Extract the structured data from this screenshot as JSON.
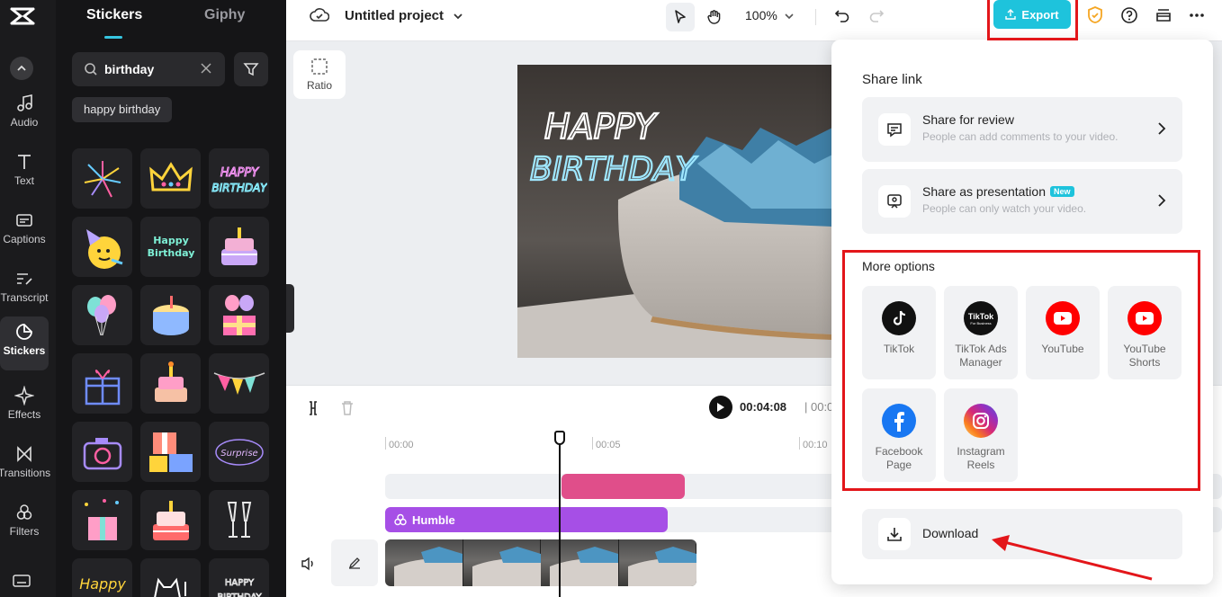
{
  "rail": {
    "items": [
      {
        "label": "Audio",
        "icon": "music-note-icon"
      },
      {
        "label": "Text",
        "icon": "text-icon"
      },
      {
        "label": "Captions",
        "icon": "captions-icon"
      },
      {
        "label": "Transcript",
        "icon": "transcript-icon"
      },
      {
        "label": "Stickers",
        "icon": "sticker-icon",
        "active": true
      },
      {
        "label": "Effects",
        "icon": "sparkle-icon"
      },
      {
        "label": "Transitions",
        "icon": "transition-icon"
      },
      {
        "label": "Filters",
        "icon": "filter-circles-icon"
      }
    ]
  },
  "panel": {
    "tabs": [
      "Stickers",
      "Giphy"
    ],
    "search": {
      "value": "birthday"
    },
    "chip": "happy birthday",
    "stickers": [
      "HAPPY BIRTHDAY",
      "Happy Birthday",
      "Surprise",
      "Happy Birthday"
    ]
  },
  "topbar": {
    "project_name": "Untitled project",
    "zoom": "100%",
    "export_label": "Export"
  },
  "canvas": {
    "ratio_label": "Ratio",
    "overlay_line1": "HAPPY",
    "overlay_line2": "BIRTHDAY"
  },
  "timeline": {
    "current_time": "00:04:08",
    "total_time_partial": "| 00:0",
    "ruler": [
      "00:00",
      "00:05",
      "00:10"
    ],
    "audio_clip_label": "Humble"
  },
  "export_menu": {
    "share_link_title": "Share link",
    "share_review": {
      "title": "Share for review",
      "desc": "People can add comments to your video."
    },
    "share_presentation": {
      "title": "Share as presentation",
      "badge": "New",
      "desc": "People can only watch your video."
    },
    "more_options_title": "More options",
    "options": [
      {
        "label": "TikTok"
      },
      {
        "label": "TikTok Ads Manager",
        "line1": "TikTok Ads",
        "line2": "Manager",
        "logo_text": "TikTok",
        "logo_sub": "For Business"
      },
      {
        "label": "YouTube"
      },
      {
        "label": "YouTube Shorts",
        "line1": "YouTube",
        "line2": "Shorts"
      },
      {
        "label": "Facebook Page",
        "line1": "Facebook",
        "line2": "Page"
      },
      {
        "label": "Instagram Reels",
        "line1": "Instagram",
        "line2": "Reels"
      }
    ],
    "download_label": "Download"
  },
  "colors": {
    "accent": "#1ec3dc",
    "highlight": "#e3161a",
    "youtube": "#ff0000",
    "facebook": "#1877f2"
  }
}
